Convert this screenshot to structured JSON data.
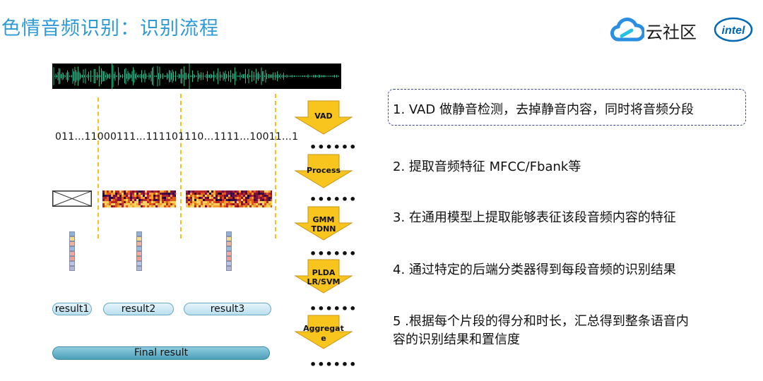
{
  "header": {
    "title": "色情音频识别：识别流程",
    "logo_text": "云社区",
    "intel_text": "intel"
  },
  "diagram": {
    "binary_string": "011…11000111…111101110…1111…10011…1",
    "results": [
      "result1",
      "result2",
      "result3"
    ],
    "final_result": "Final result",
    "arrows": [
      {
        "lines": [
          "VAD"
        ]
      },
      {
        "lines": [
          "Process"
        ]
      },
      {
        "lines": [
          "GMM",
          "TDNN"
        ]
      },
      {
        "lines": [
          "PLDA",
          "LR/SVM"
        ]
      },
      {
        "lines": [
          "Aggregat",
          "e"
        ]
      }
    ],
    "dots": "••••••"
  },
  "steps": [
    {
      "text": "1. VAD 做静音检测，去掉静音内容，同时将音频分段"
    },
    {
      "text": "2. 提取音频特征 MFCC/Fbank等"
    },
    {
      "text": "3. 在通用模型上提取能够表征该段音频内容的特征"
    },
    {
      "text": "4. 通过特定的后端分类器得到每段音频的识别结果"
    },
    {
      "text": "5 .根据每个片段的得分和时长，汇总得到整条语音内"
    },
    {
      "text": "容的识别结果和置信度"
    }
  ],
  "colors": {
    "title": "#2f9bd6",
    "arrow_fill": "#f7c51e",
    "dash": "#f2c21a",
    "wave": "#2fb889"
  }
}
